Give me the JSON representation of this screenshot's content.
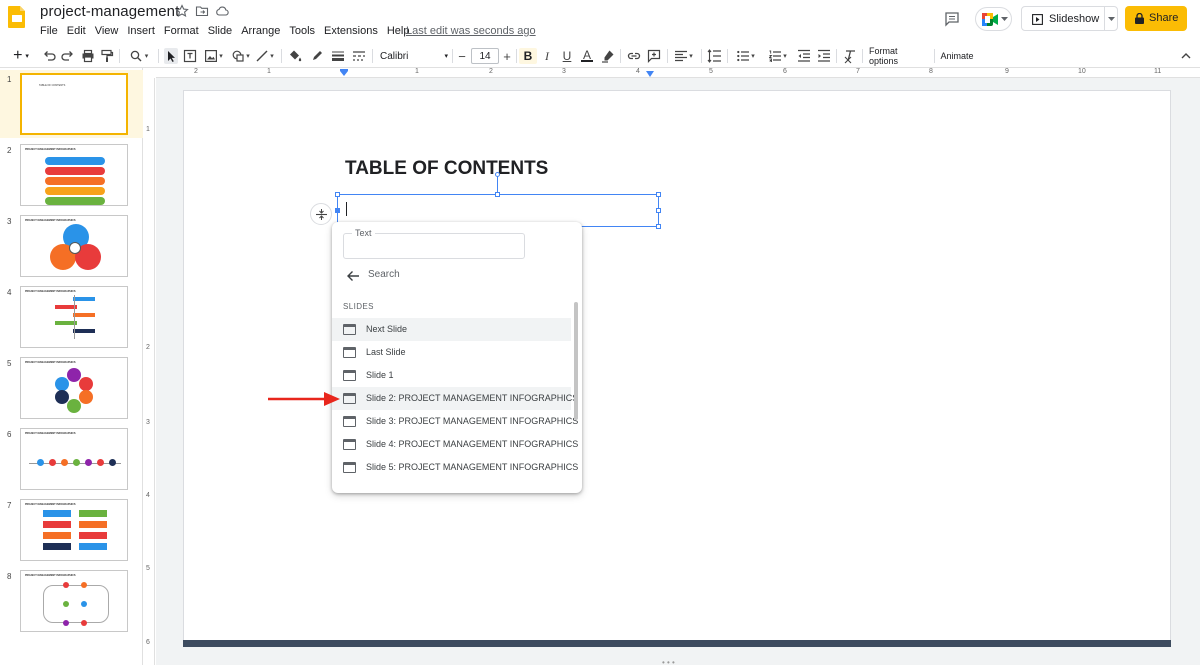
{
  "app": {
    "title": "project-management",
    "last_edit": "Last edit was seconds ago",
    "brand_color": "#fbbc04",
    "menus": [
      "File",
      "Edit",
      "View",
      "Insert",
      "Format",
      "Slide",
      "Arrange",
      "Tools",
      "Extensions",
      "Help"
    ],
    "slideshow_label": "Slideshow",
    "share_label": "Share"
  },
  "toolbar": {
    "font": "Calibri",
    "font_size": "14",
    "format_options": "Format options",
    "animate": "Animate"
  },
  "rulers": {
    "h": [
      "2",
      "1",
      "1",
      "2",
      "3",
      "4",
      "5",
      "6",
      "7",
      "8",
      "9",
      "10",
      "11"
    ],
    "v": [
      "1",
      "2",
      "3",
      "4",
      "5",
      "6"
    ]
  },
  "filmstrip": {
    "slides": [
      {
        "num": "1",
        "caption": "TABLE OF CONTENTS"
      },
      {
        "num": "2",
        "caption": "PROJECT MANAGEMENT INFOGRAPHICS"
      },
      {
        "num": "3",
        "caption": "PROJECT MANAGEMENT INFOGRAPHICS"
      },
      {
        "num": "4",
        "caption": "PROJECT MANAGEMENT INFOGRAPHICS"
      },
      {
        "num": "5",
        "caption": "PROJECT MANAGEMENT INFOGRAPHICS"
      },
      {
        "num": "6",
        "caption": "PROJECT MANAGEMENT INFOGRAPHICS"
      },
      {
        "num": "7",
        "caption": "PROJECT MANAGEMENT INFOGRAPHICS"
      },
      {
        "num": "8",
        "caption": "PROJECT MANAGEMENT INFOGRAPHICS"
      }
    ]
  },
  "slide": {
    "title": "TABLE OF CONTENTS",
    "footer_bar_color": "#3d4b5f"
  },
  "link_popup": {
    "text_label": "Text",
    "text_value": "",
    "search_label": "Search",
    "section_header": "SLIDES",
    "items": [
      "Next Slide",
      "Last Slide",
      "Slide 1",
      "Slide 2: PROJECT MANAGEMENT INFOGRAPHICS",
      "Slide 3: PROJECT MANAGEMENT INFOGRAPHICS",
      "Slide 4: PROJECT MANAGEMENT INFOGRAPHICS",
      "Slide 5: PROJECT MANAGEMENT INFOGRAPHICS"
    ],
    "highlighted_index": 0
  },
  "annotation": {
    "arrow_color": "#e8261c"
  }
}
